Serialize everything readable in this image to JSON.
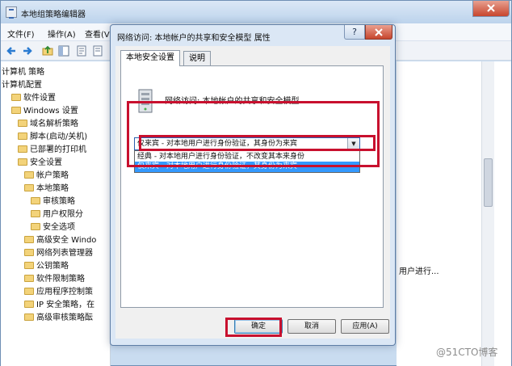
{
  "main_window": {
    "title": "本地组策略编辑器",
    "menu": [
      "文件(F)",
      "操作(A)",
      "查看(V)"
    ],
    "tree_items": [
      "计算机 策略",
      "计算机配置",
      "软件设置",
      "Windows 设置",
      "域名解析策略",
      "脚本(启动/关机)",
      "已部署的打印机",
      "安全设置",
      "帐户策略",
      "本地策略",
      "审核策略",
      "用户权限分",
      "安全选项",
      "高级安全 Windo",
      "网络列表管理器",
      "公钥策略",
      "软件限制策略",
      "应用程序控制策",
      "IP 安全策略，在",
      "高级审核策略酝"
    ],
    "right_pane_text": "用户进行..."
  },
  "dialog": {
    "title": "网络访问: 本地帐户的共享和安全模型 属性",
    "tabs": [
      "本地安全设置",
      "说明"
    ],
    "policy_name": "网络访问: 本地帐户的共享和安全模型",
    "combo_value": "仅来宾 - 对本地用户进行身份验证，其身份为来宾",
    "options": [
      "经典 - 对本地用户进行身份验证，不改变其本来身份",
      "仅来宾 - 对本地用户进行身份验证，其身份为来宾"
    ],
    "buttons": {
      "ok": "确定",
      "cancel": "取消",
      "apply": "应用(A)"
    }
  },
  "watermark": "@51CTO博客",
  "colors": {
    "highlight_box": "#c8102e",
    "selection": "#3399ff"
  }
}
